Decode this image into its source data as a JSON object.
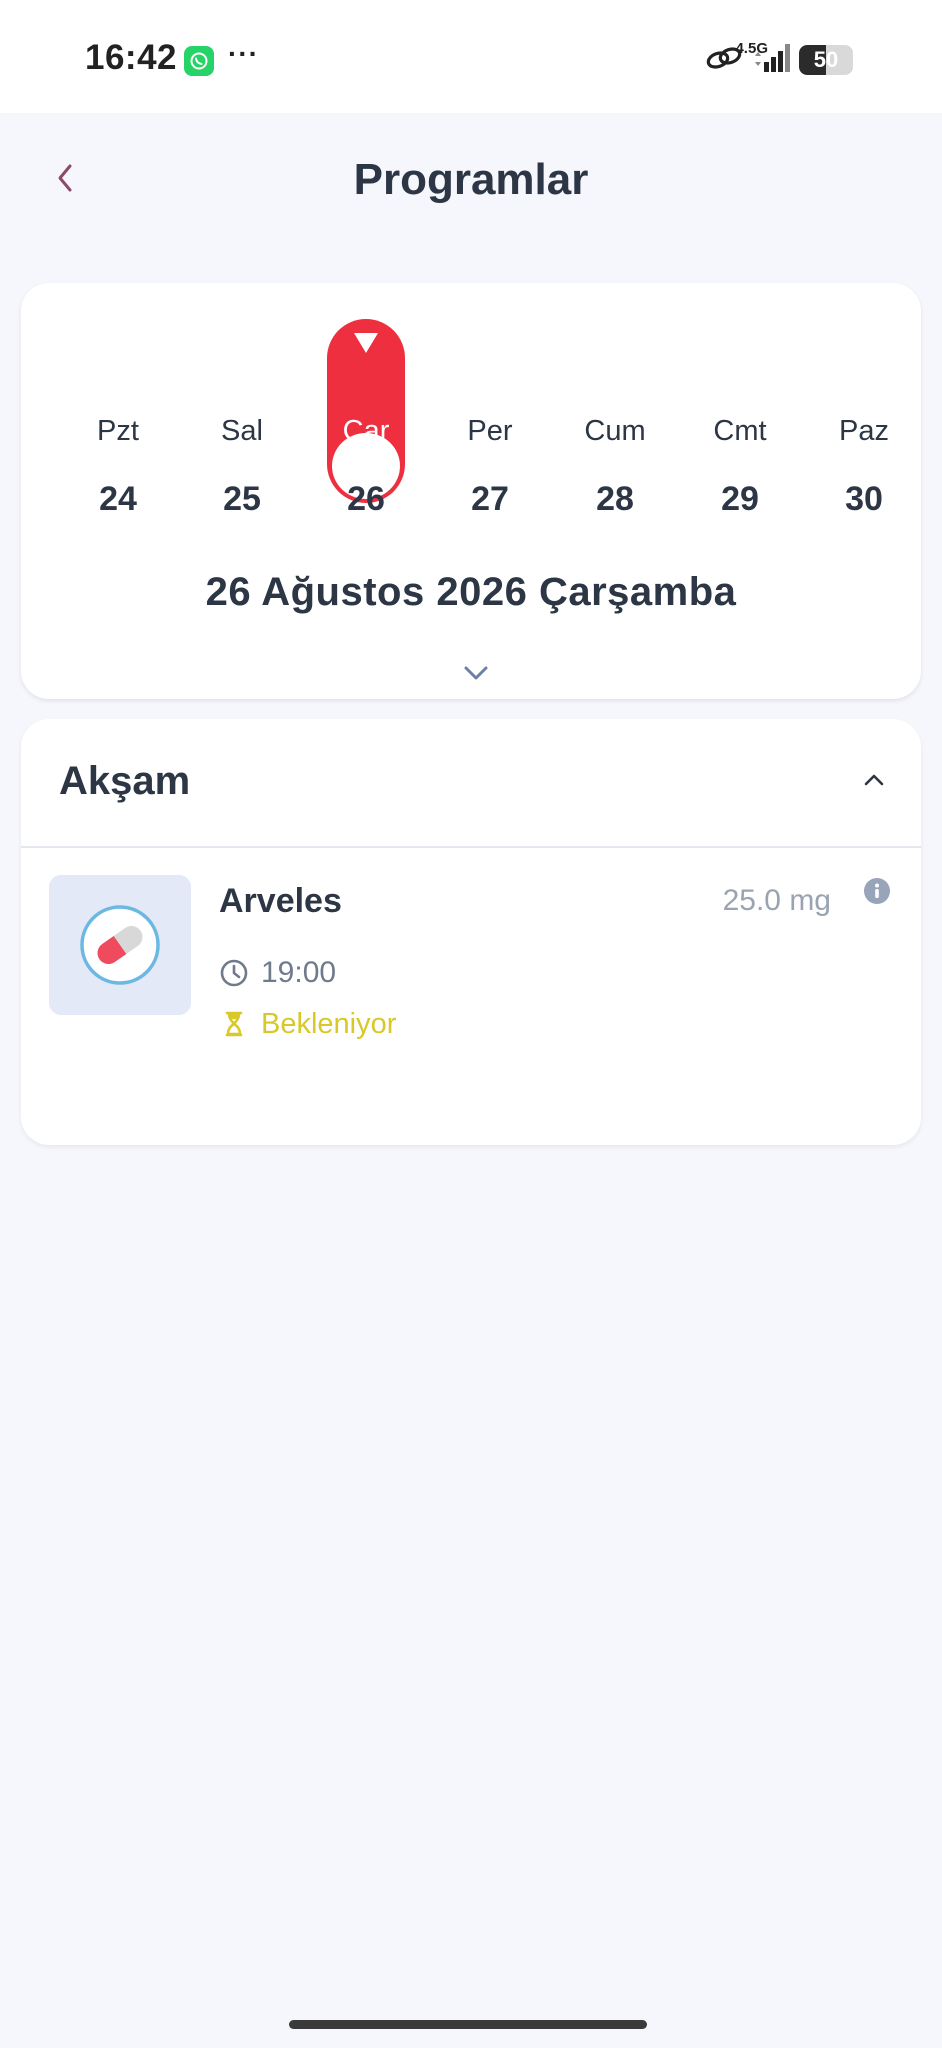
{
  "status_bar": {
    "time": "16:42",
    "notification_icons": [
      "whatsapp-icon",
      "more-dots"
    ],
    "dots": "···",
    "network_label": "4.5G",
    "battery_level": "50",
    "battery_fraction": 0.5
  },
  "header": {
    "title": "Programlar",
    "back_icon": "chevron-left-icon",
    "accent_color": "#8b4a67"
  },
  "calendar": {
    "days": [
      {
        "name": "Pzt",
        "number": "24",
        "selected": false
      },
      {
        "name": "Sal",
        "number": "25",
        "selected": false
      },
      {
        "name": "Çar",
        "number": "26",
        "selected": true
      },
      {
        "name": "Per",
        "number": "27",
        "selected": false
      },
      {
        "name": "Cum",
        "number": "28",
        "selected": false
      },
      {
        "name": "Cmt",
        "number": "29",
        "selected": false
      },
      {
        "name": "Paz",
        "number": "30",
        "selected": false
      }
    ],
    "selected_date_label": "26 Ağustos 2026 Çarşamba",
    "selected_color": "#ee2f40",
    "expand_icon": "chevron-down-icon"
  },
  "schedule": {
    "section_title": "Akşam",
    "collapse_icon": "chevron-up-icon",
    "items": [
      {
        "name": "Arveles",
        "dose": "25.0 mg",
        "time": "19:00",
        "status": "Bekleniyor",
        "status_color": "#d9c82a",
        "thumbnail_icon": "pill-capsule-icon"
      }
    ]
  }
}
